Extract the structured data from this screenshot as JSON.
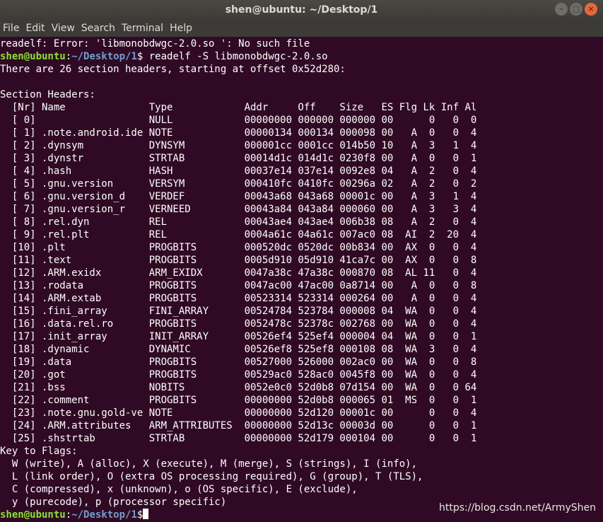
{
  "window": {
    "title": "shen@ubuntu: ~/Desktop/1",
    "controls": {
      "minimize_icon": "–",
      "maximize_icon": "□",
      "close_icon": "×"
    }
  },
  "menu": [
    "File",
    "Edit",
    "View",
    "Search",
    "Terminal",
    "Help"
  ],
  "prompt": {
    "userhost": "shen@ubuntu",
    "path": "~/Desktop/1",
    "symbol": "$"
  },
  "lines": [
    {
      "text": "readelf: Error: 'libmonobdwgc-2.0.so ': No such file"
    },
    {
      "prompt": true,
      "cmd": " readelf -S libmonobdwgc-2.0.so"
    },
    {
      "text": "There are 26 section headers, starting at offset 0x52d280:"
    },
    {
      "text": ""
    },
    {
      "text": "Section Headers:"
    },
    {
      "text": "  [Nr] Name              Type            Addr     Off    Size   ES Flg Lk Inf Al"
    },
    {
      "text": "  [ 0]                   NULL            00000000 000000 000000 00      0   0  0"
    },
    {
      "text": "  [ 1] .note.android.ide NOTE            00000134 000134 000098 00   A  0   0  4"
    },
    {
      "text": "  [ 2] .dynsym           DYNSYM          000001cc 0001cc 014b50 10   A  3   1  4"
    },
    {
      "text": "  [ 3] .dynstr           STRTAB          00014d1c 014d1c 0230f8 00   A  0   0  1"
    },
    {
      "text": "  [ 4] .hash             HASH            00037e14 037e14 0092e8 04   A  2   0  4"
    },
    {
      "text": "  [ 5] .gnu.version      VERSYM          000410fc 0410fc 00296a 02   A  2   0  2"
    },
    {
      "text": "  [ 6] .gnu.version_d    VERDEF          00043a68 043a68 00001c 00   A  3   1  4"
    },
    {
      "text": "  [ 7] .gnu.version_r    VERNEED         00043a84 043a84 000060 00   A  3   3  4"
    },
    {
      "text": "  [ 8] .rel.dyn          REL             00043ae4 043ae4 006b38 08   A  2   0  4"
    },
    {
      "text": "  [ 9] .rel.plt          REL             0004a61c 04a61c 007ac0 08  AI  2  20  4"
    },
    {
      "text": "  [10] .plt              PROGBITS        000520dc 0520dc 00b834 00  AX  0   0  4"
    },
    {
      "text": "  [11] .text             PROGBITS        0005d910 05d910 41ca7c 00  AX  0   0  8"
    },
    {
      "text": "  [12] .ARM.exidx        ARM_EXIDX       0047a38c 47a38c 000870 08  AL 11   0  4"
    },
    {
      "text": "  [13] .rodata           PROGBITS        0047ac00 47ac00 0a8714 00   A  0   0  8"
    },
    {
      "text": "  [14] .ARM.extab        PROGBITS        00523314 523314 000264 00   A  0   0  4"
    },
    {
      "text": "  [15] .fini_array       FINI_ARRAY      00524784 523784 000008 04  WA  0   0  4"
    },
    {
      "text": "  [16] .data.rel.ro      PROGBITS        0052478c 52378c 002768 00  WA  0   0  4"
    },
    {
      "text": "  [17] .init_array       INIT_ARRAY      00526ef4 525ef4 000004 04  WA  0   0  1"
    },
    {
      "text": "  [18] .dynamic          DYNAMIC         00526ef8 525ef8 000108 08  WA  3   0  4"
    },
    {
      "text": "  [19] .data             PROGBITS        00527000 526000 002ac0 00  WA  0   0  8"
    },
    {
      "text": "  [20] .got              PROGBITS        00529ac0 528ac0 0045f8 00  WA  0   0  4"
    },
    {
      "text": "  [21] .bss              NOBITS          0052e0c0 52d0b8 07d154 00  WA  0   0 64"
    },
    {
      "text": "  [22] .comment          PROGBITS        00000000 52d0b8 000065 01  MS  0   0  1"
    },
    {
      "text": "  [23] .note.gnu.gold-ve NOTE            00000000 52d120 00001c 00      0   0  4"
    },
    {
      "text": "  [24] .ARM.attributes   ARM_ATTRIBUTES  00000000 52d13c 00003d 00      0   0  1"
    },
    {
      "text": "  [25] .shstrtab         STRTAB          00000000 52d179 000104 00      0   0  1"
    },
    {
      "text": "Key to Flags:"
    },
    {
      "text": "  W (write), A (alloc), X (execute), M (merge), S (strings), I (info),"
    },
    {
      "text": "  L (link order), O (extra OS processing required), G (group), T (TLS),"
    },
    {
      "text": "  C (compressed), x (unknown), o (OS specific), E (exclude),"
    },
    {
      "text": "  y (purecode), p (processor specific)"
    },
    {
      "prompt": true,
      "cmd": "",
      "cursor": true
    }
  ],
  "watermark": "https://blog.csdn.net/ArmyShen",
  "colors": {
    "background": "#300a24",
    "foreground": "#ffffff",
    "prompt_user": "#8ae234",
    "prompt_path": "#729fcf",
    "titlebar": "#3c3b37",
    "close_button": "#e8683b"
  }
}
